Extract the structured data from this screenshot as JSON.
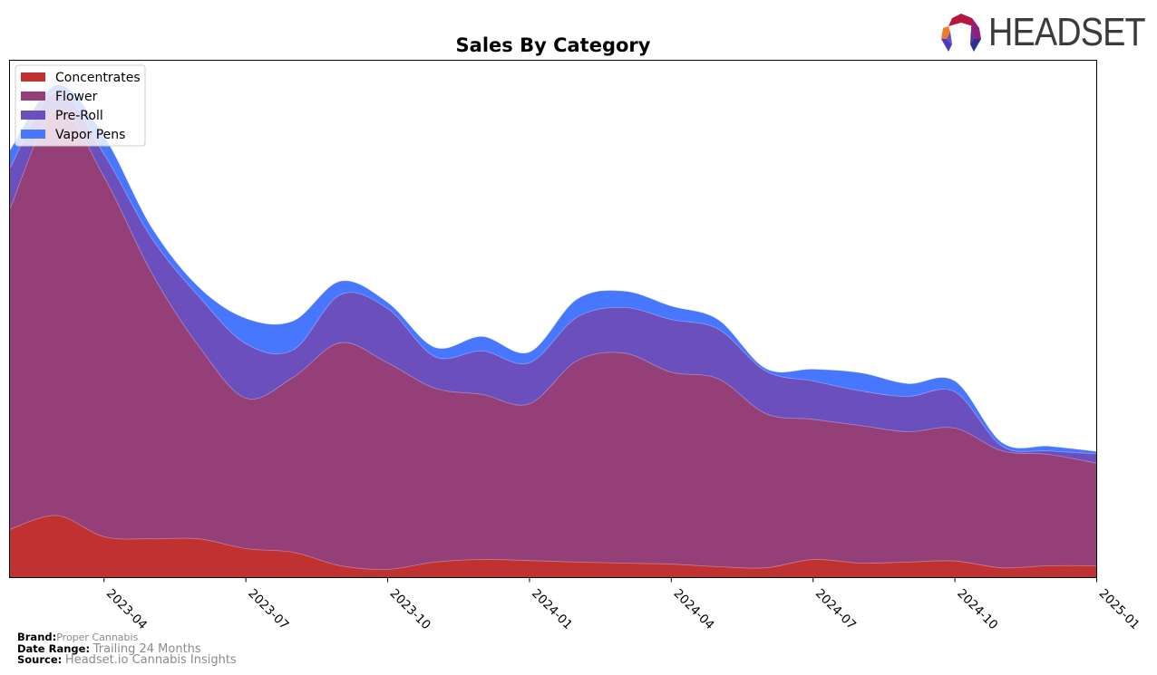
{
  "logo": {
    "text": "HEADSET",
    "icon": "headset-logo-icon"
  },
  "footer": {
    "brand_label": "Brand:",
    "brand_value": "Proper Cannabis",
    "date_range_label": "Date Range:",
    "date_range_value": "Trailing 24 Months",
    "source_label": "Source:",
    "source_value": "Headset.io Cannabis Insights"
  },
  "chart_data": {
    "type": "area",
    "stacked": true,
    "title": "Sales By Category",
    "xlabel": "",
    "ylabel": "",
    "y_ticks_visible": false,
    "ylim": [
      0,
      100
    ],
    "grid": false,
    "legend_position": "top-left",
    "x": [
      "2023-02",
      "2023-03",
      "2023-04",
      "2023-05",
      "2023-06",
      "2023-07",
      "2023-08",
      "2023-09",
      "2023-10",
      "2023-11",
      "2023-12",
      "2024-01",
      "2024-02",
      "2024-03",
      "2024-04",
      "2024-05",
      "2024-06",
      "2024-07",
      "2024-08",
      "2024-09",
      "2024-10",
      "2024-11",
      "2024-12",
      "2025-01"
    ],
    "x_ticks": [
      "2023-04",
      "2023-07",
      "2023-10",
      "2024-01",
      "2024-04",
      "2024-07",
      "2024-10",
      "2025-01"
    ],
    "series": [
      {
        "name": "Concentrates",
        "color": "#c03232",
        "values": [
          9.3,
          12.0,
          7.9,
          7.5,
          7.5,
          5.6,
          4.9,
          2.3,
          1.6,
          3.0,
          3.5,
          3.3,
          3.0,
          2.8,
          2.6,
          2.1,
          1.9,
          3.5,
          2.8,
          3.0,
          3.2,
          1.9,
          2.3,
          2.3
        ]
      },
      {
        "name": "Flower",
        "color": "#953f78",
        "values": [
          61.8,
          78.5,
          69.5,
          51.5,
          37.3,
          29.1,
          33.8,
          43.1,
          39.9,
          33.6,
          31.9,
          30.3,
          38.9,
          40.6,
          37.1,
          36.3,
          29.8,
          27.1,
          26.6,
          25.2,
          25.7,
          22.6,
          21.5,
          19.8
        ]
      },
      {
        "name": "Pre-Roll",
        "color": "#6a4fbd",
        "values": [
          7.9,
          3.5,
          4.4,
          6.7,
          9.6,
          10.5,
          5.3,
          9.3,
          10.5,
          6.1,
          8.4,
          7.9,
          8.4,
          8.8,
          10.2,
          9.6,
          8.2,
          7.4,
          6.7,
          6.8,
          7.0,
          0.9,
          0.7,
          1.8
        ]
      },
      {
        "name": "Vapor Pens",
        "color": "#4877ff",
        "values": [
          3.5,
          1.2,
          3.5,
          2.1,
          1.8,
          4.9,
          5.6,
          2.6,
          1.2,
          1.8,
          2.8,
          2.1,
          3.5,
          3.2,
          2.6,
          1.8,
          0.5,
          2.3,
          3.5,
          2.5,
          2.1,
          0.7,
          0.9,
          0.5
        ]
      }
    ]
  }
}
